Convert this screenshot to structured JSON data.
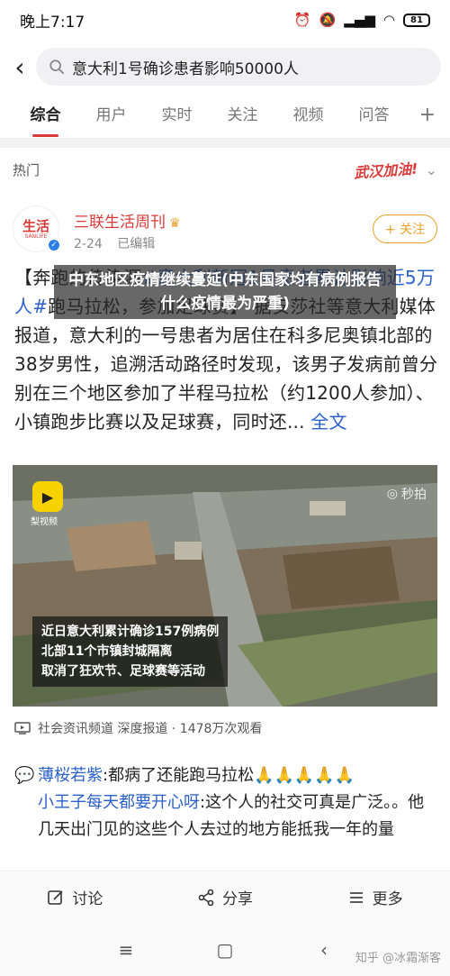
{
  "status_bar": {
    "time": "晚上7:17",
    "battery": "81"
  },
  "search": {
    "query": "意大利1号确诊患者影响50000人"
  },
  "tabs": [
    {
      "label": "综合",
      "active": true
    },
    {
      "label": "用户",
      "active": false
    },
    {
      "label": "实时",
      "active": false
    },
    {
      "label": "关注",
      "active": false
    },
    {
      "label": "视频",
      "active": false
    },
    {
      "label": "问答",
      "active": false
    }
  ],
  "hot": {
    "label": "热门",
    "slogan": "武汉加油!"
  },
  "post": {
    "avatar_text": "生活",
    "avatar_sub": "SANLIFE",
    "author": "三联生活周刊",
    "date": "2-24",
    "edited": "已编辑",
    "follow_label": "+ 关注",
    "body_prefix": "【奔跑的传染源",
    "topic1": "#意大利新冠1号患者累计影响近5万人#",
    "body_mid": "跑马拉松，参加足球赛】 据安莎社等意大利媒体报道，意大利的一号患者为居住在科多尼奥镇北部的38岁男性，追溯活动路径时发现，该男子发病前曾分别在三个地区参加了半程马拉松（约1200人参加）、小镇跑步比赛以及足球赛，同时还...",
    "more_link": "全文",
    "video_overlay_title": "中东地区疫情继续蔓延(中东国家均有病例报告什么疫情最为严重)",
    "video_logo_label": "梨视频",
    "video_watermark": "秒拍",
    "video_caption": [
      "近日意大利累计确诊157例病例",
      "北部11个市镇封城隔离",
      "取消了狂欢节、足球赛等活动"
    ],
    "video_info": "社会资讯频道 深度报道 · 1478万次观看"
  },
  "comments": [
    {
      "name": "薄桜若紫",
      "text": ":都病了还能跑马拉松🙏🙏🙏🙏🙏"
    },
    {
      "name": "小王子每天都要开心呀",
      "text": ":这个人的社交可真是广泛。。他几天出门见的这些个人去过的地方能抵我一年的量"
    }
  ],
  "actions": {
    "comment": "讨论",
    "share": "分享",
    "more": "更多"
  },
  "nav": {
    "watermark": "知乎 @冰霜渐客"
  }
}
